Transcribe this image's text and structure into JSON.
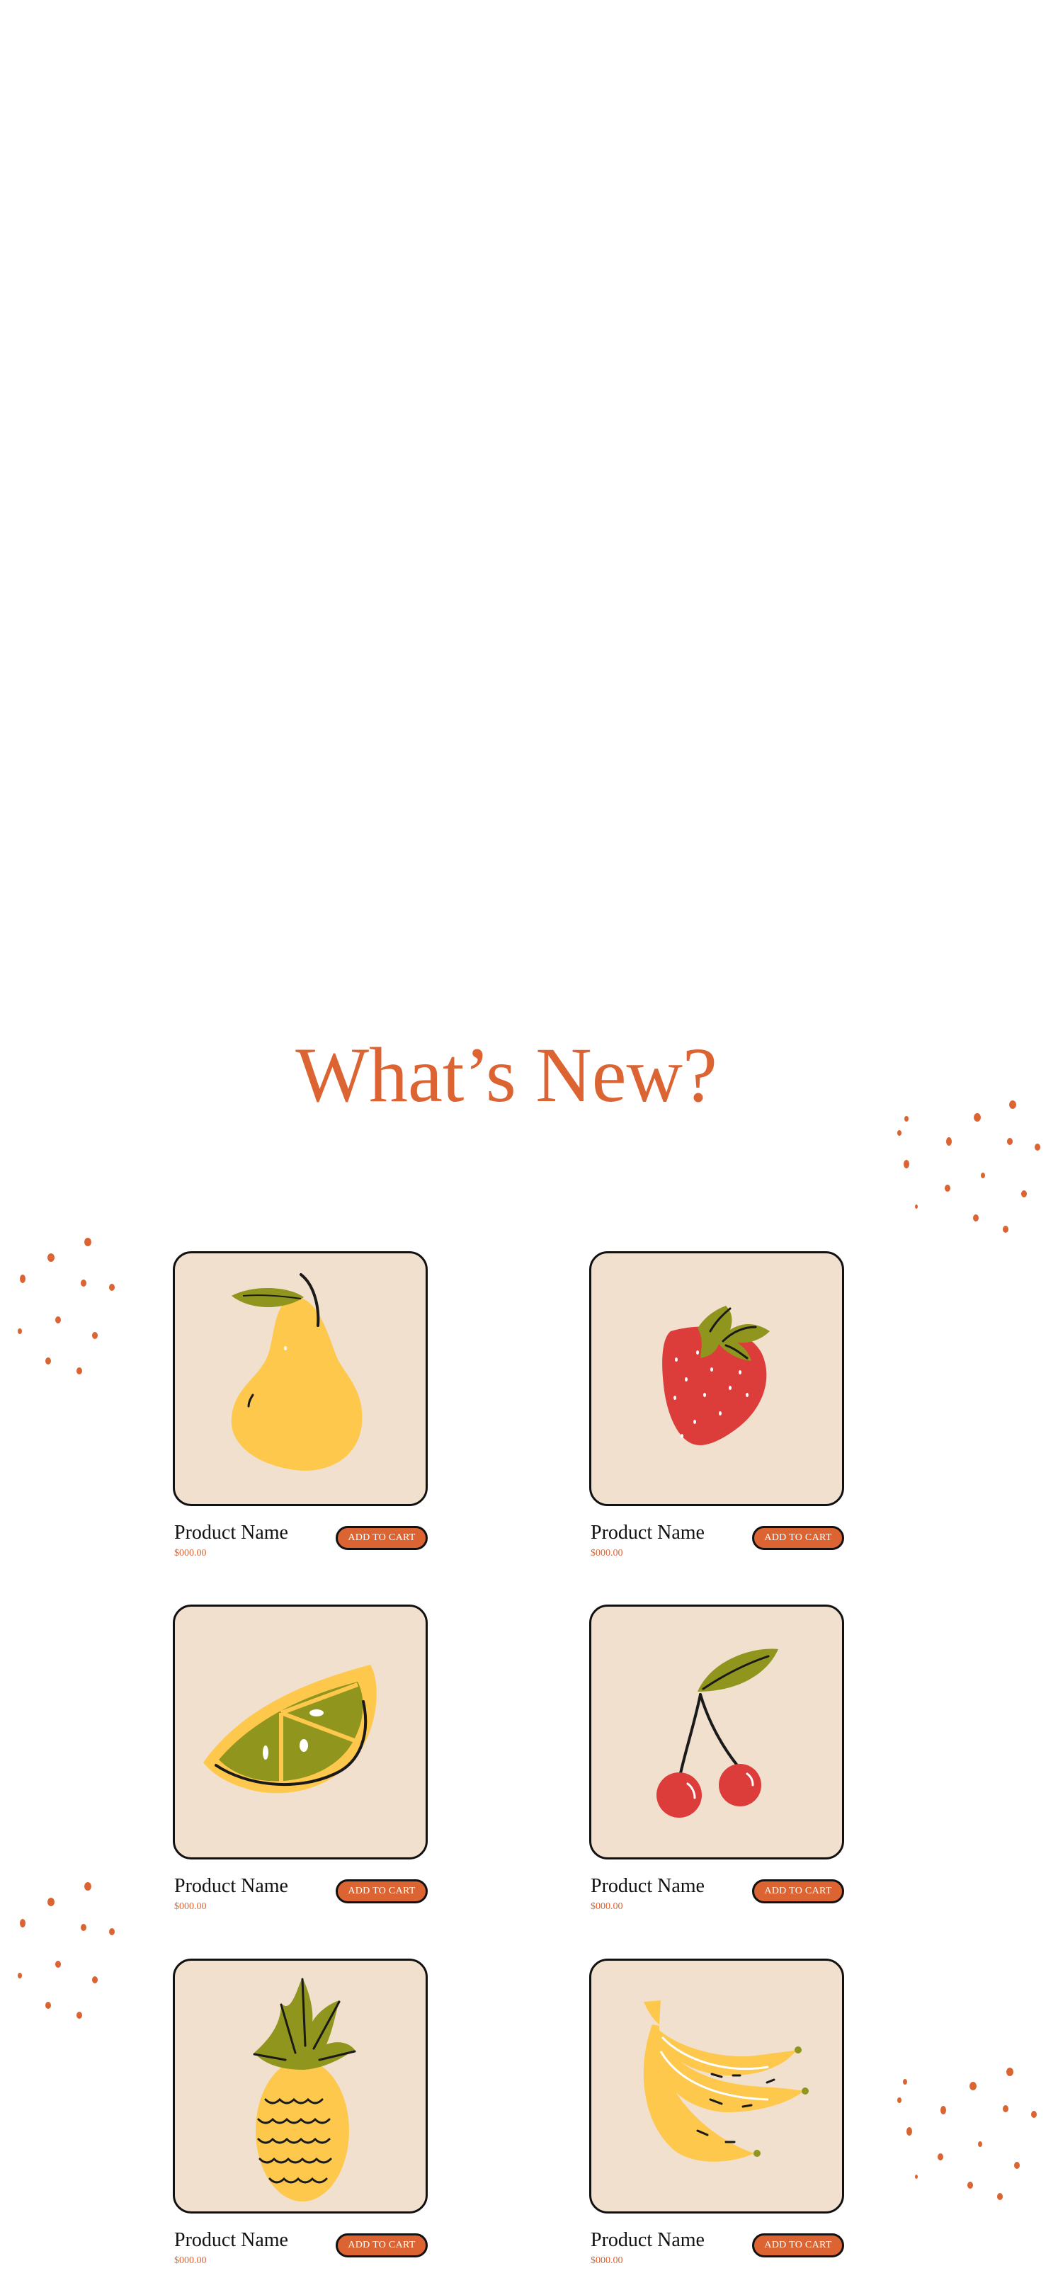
{
  "section": {
    "title": "What’s New?"
  },
  "colors": {
    "accent": "#dc6432",
    "card_bg": "#f2e0cf",
    "border": "#111111"
  },
  "products": [
    {
      "name": "Product Name",
      "price": "$000.00",
      "button": "ADD TO CART",
      "icon": "pear-icon"
    },
    {
      "name": "Product Name",
      "price": "$000.00",
      "button": "ADD TO CART",
      "icon": "strawberry-icon"
    },
    {
      "name": "Product Name",
      "price": "$000.00",
      "button": "ADD TO CART",
      "icon": "orange-slice-icon"
    },
    {
      "name": "Product Name",
      "price": "$000.00",
      "button": "ADD TO CART",
      "icon": "cherries-icon"
    },
    {
      "name": "Product Name",
      "price": "$000.00",
      "button": "ADD TO CART",
      "icon": "pineapple-icon"
    },
    {
      "name": "Product Name",
      "price": "$000.00",
      "button": "ADD TO CART",
      "icon": "bananas-icon"
    }
  ]
}
